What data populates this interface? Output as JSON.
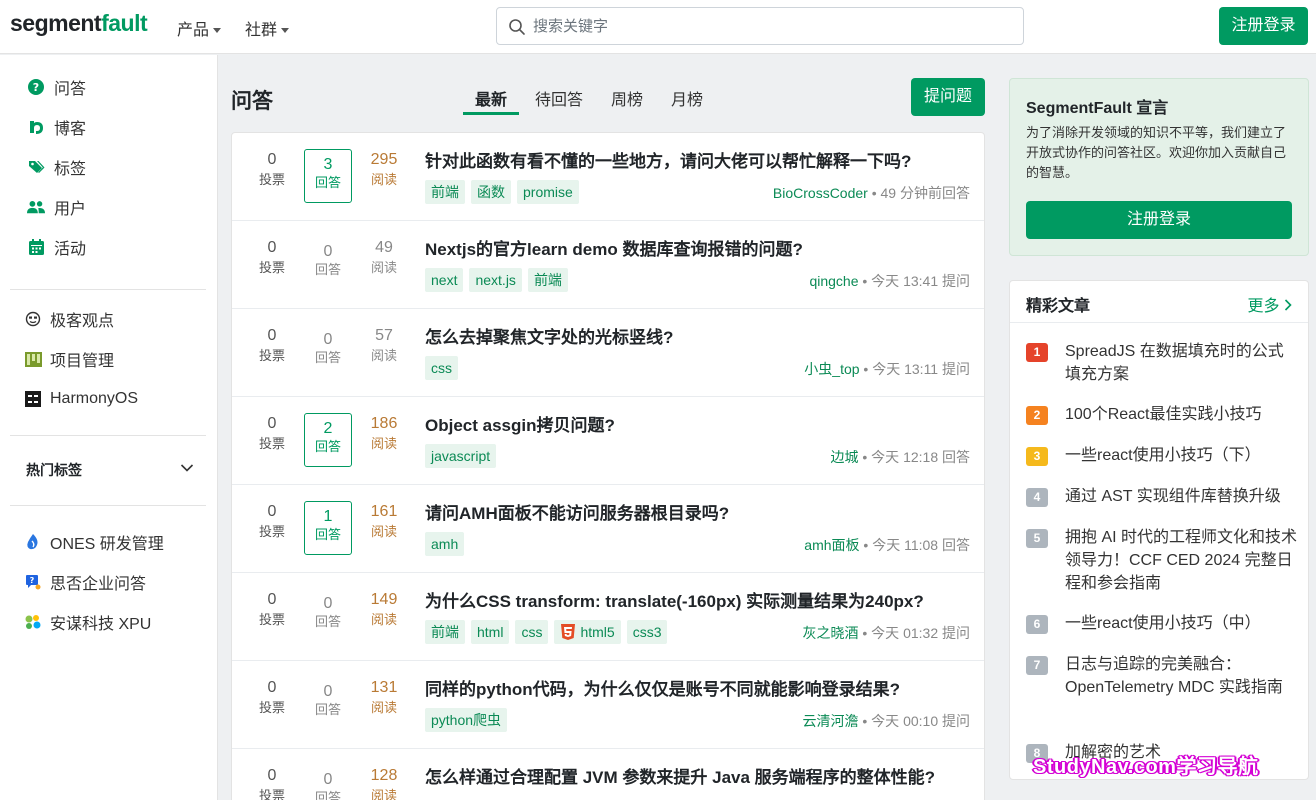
{
  "header": {
    "logo_a": "segment",
    "logo_b": "fault",
    "menu_products": "产品",
    "menu_community": "社群",
    "search_placeholder": "搜索关键字",
    "register_login": "注册登录"
  },
  "sidebar": {
    "nav": [
      {
        "label": "问答"
      },
      {
        "label": "博客"
      },
      {
        "label": "标签"
      },
      {
        "label": "用户"
      },
      {
        "label": "活动"
      }
    ],
    "nav2": [
      {
        "label": "极客观点"
      },
      {
        "label": "项目管理"
      },
      {
        "label": "HarmonyOS"
      }
    ],
    "hot_tags": "热门标签",
    "partners": [
      {
        "label": "ONES 研发管理"
      },
      {
        "label": "思否企业问答"
      },
      {
        "label": "安谋科技 XPU"
      }
    ]
  },
  "main": {
    "title": "问答",
    "tabs": [
      "最新",
      "待回答",
      "周榜",
      "月榜"
    ],
    "ask_button": "提问题",
    "vote_label": "投票",
    "answer_label": "回答",
    "view_label": "阅读",
    "questions": [
      {
        "votes": "0",
        "answers": "3",
        "views": "295",
        "title": "针对此函数有看不懂的一些地方，请问大佬可以帮忙解释一下吗?",
        "tags": [
          "前端",
          "函数",
          "promise"
        ],
        "user": "BioCrossCoder",
        "time": "• 49 分钟前回答"
      },
      {
        "votes": "0",
        "answers": "0",
        "views": "49",
        "title": "Nextjs的官方learn demo 数据库查询报错的问题?",
        "tags": [
          "next",
          "next.js",
          "前端"
        ],
        "user": "qingche",
        "time": "• 今天 13:41 提问"
      },
      {
        "votes": "0",
        "answers": "0",
        "views": "57",
        "title": "怎么去掉聚焦文字处的光标竖线?",
        "tags": [
          "css"
        ],
        "user": "小虫_top",
        "time": "• 今天 13:11 提问"
      },
      {
        "votes": "0",
        "answers": "2",
        "views": "186",
        "title": "Object assgin拷贝问题?",
        "tags": [
          "javascript"
        ],
        "user": "边城",
        "time": "• 今天 12:18 回答"
      },
      {
        "votes": "0",
        "answers": "1",
        "views": "161",
        "title": "请问AMH面板不能访问服务器根目录吗?",
        "tags": [
          "amh"
        ],
        "user": "amh面板",
        "time": "• 今天 11:08 回答"
      },
      {
        "votes": "0",
        "answers": "0",
        "views": "149",
        "title": "为什么CSS transform: translate(-160px) 实际测量结果为240px?",
        "tags": [
          "前端",
          "html",
          "css",
          "html5",
          "css3"
        ],
        "user": "灰之晓酒",
        "time": "• 今天 01:32 提问"
      },
      {
        "votes": "0",
        "answers": "0",
        "views": "131",
        "title": "同样的python代码，为什么仅仅是账号不同就能影响登录结果?",
        "tags": [
          "python爬虫"
        ],
        "user": "云清河澹",
        "time": "• 今天 00:10 提问"
      },
      {
        "votes": "0",
        "answers": "0",
        "views": "128",
        "title": "怎么样通过合理配置 JVM 参数来提升 Java 服务端程序的整体性能?",
        "tags": [],
        "user": "",
        "time": ""
      }
    ]
  },
  "right": {
    "announce_title": "SegmentFault 宣言",
    "announce_text": "为了消除开发领域的知识不平等，我们建立了开放式协作的问答社区。欢迎你加入贡献自己的智慧。",
    "announce_button": "注册登录",
    "articles_title": "精彩文章",
    "articles_more": "更多",
    "articles": [
      {
        "rank": "1",
        "title": "SpreadJS 在数据填充时的公式填充方案",
        "color": "#e5432a"
      },
      {
        "rank": "2",
        "title": "100个React最佳实践小技巧",
        "color": "#f58220"
      },
      {
        "rank": "3",
        "title": "一些react使用小技巧（下）",
        "color": "#f5b91c"
      },
      {
        "rank": "4",
        "title": "通过 AST 实现组件库替换升级",
        "color": "#adb5bd"
      },
      {
        "rank": "5",
        "title": "拥抱 AI 时代的工程师文化和技术领导力！CCF CED 2024 完整日程和参会指南",
        "color": "#adb5bd"
      },
      {
        "rank": "6",
        "title": "一些react使用小技巧（中）",
        "color": "#adb5bd"
      },
      {
        "rank": "7",
        "title": "日志与追踪的完美融合：OpenTelemetry MDC 实践指南",
        "color": "#adb5bd"
      },
      {
        "rank": "8",
        "title": "加解密的艺术",
        "color": "#adb5bd"
      }
    ]
  },
  "watermark": "StudyNav.com学习导航"
}
